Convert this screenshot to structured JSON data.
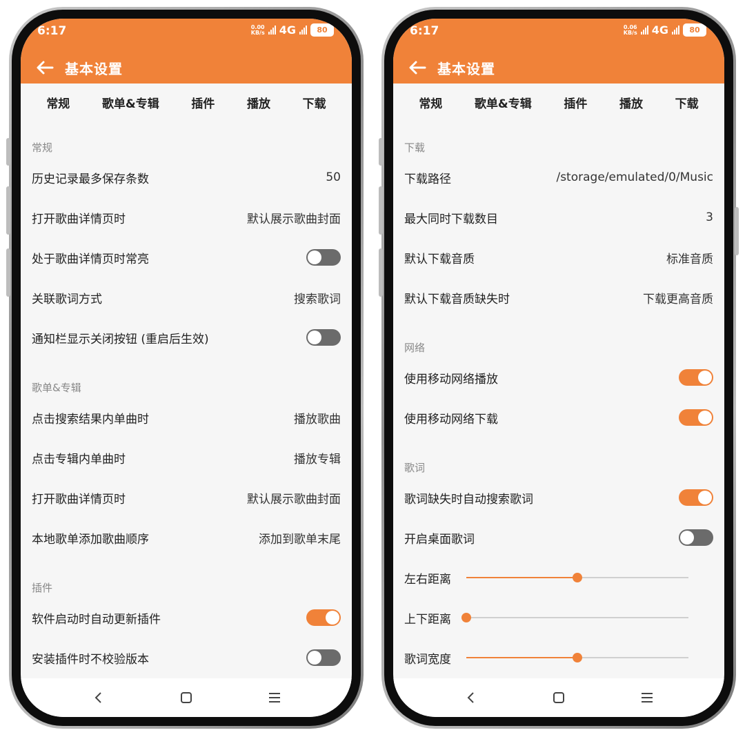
{
  "status": {
    "time": "6:17",
    "speed_left": "0.00",
    "speed_right": "0.06",
    "speed_unit": "KB/s",
    "network": "4G",
    "battery": "80"
  },
  "header": {
    "title": "基本设置"
  },
  "tabs": [
    "常规",
    "歌单&专辑",
    "插件",
    "播放",
    "下载"
  ],
  "left": {
    "sec_general": "常规",
    "history_label": "历史记录最多保存条数",
    "history_value": "50",
    "open_detail_label": "打开歌曲详情页时",
    "open_detail_value": "默认展示歌曲封面",
    "keep_on_label": "处于歌曲详情页时常亮",
    "lyric_link_label": "关联歌词方式",
    "lyric_link_value": "搜索歌词",
    "notif_close_label": "通知栏显示关闭按钮 (重启后生效)",
    "sec_playlist": "歌单&专辑",
    "click_search_label": "点击搜索结果内单曲时",
    "click_search_value": "播放歌曲",
    "click_album_label": "点击专辑内单曲时",
    "click_album_value": "播放专辑",
    "open_detail2_label": "打开歌曲详情页时",
    "open_detail2_value": "默认展示歌曲封面",
    "local_add_label": "本地歌单添加歌曲顺序",
    "local_add_value": "添加到歌单末尾",
    "sec_plugin": "插件",
    "auto_update_label": "软件启动时自动更新插件",
    "no_verify_label": "安装插件时不校验版本"
  },
  "right": {
    "sec_download": "下载",
    "path_label": "下载路径",
    "path_value": "/storage/emulated/0/Music",
    "max_dl_label": "最大同时下载数目",
    "max_dl_value": "3",
    "quality_label": "默认下载音质",
    "quality_value": "标准音质",
    "missing_label": "默认下载音质缺失时",
    "missing_value": "下载更高音质",
    "sec_network": "网络",
    "mobile_play_label": "使用移动网络播放",
    "mobile_dl_label": "使用移动网络下载",
    "sec_lyrics": "歌词",
    "auto_search_label": "歌词缺失时自动搜索歌词",
    "desktop_lyric_label": "开启桌面歌词",
    "lr_label": "左右距离",
    "ud_label": "上下距离",
    "width_label": "歌词宽度"
  },
  "toggles": {
    "keep_on": false,
    "notif_close": false,
    "auto_update": true,
    "no_verify": false,
    "mobile_play": true,
    "mobile_dl": true,
    "auto_search": true,
    "desktop_lyric": false
  },
  "sliders": {
    "lr_distance": 0.5,
    "ud_distance": 0.0,
    "lyric_width": 0.5
  },
  "colors": {
    "accent": "#f08239",
    "toggle_off": "#6b6b6b"
  }
}
